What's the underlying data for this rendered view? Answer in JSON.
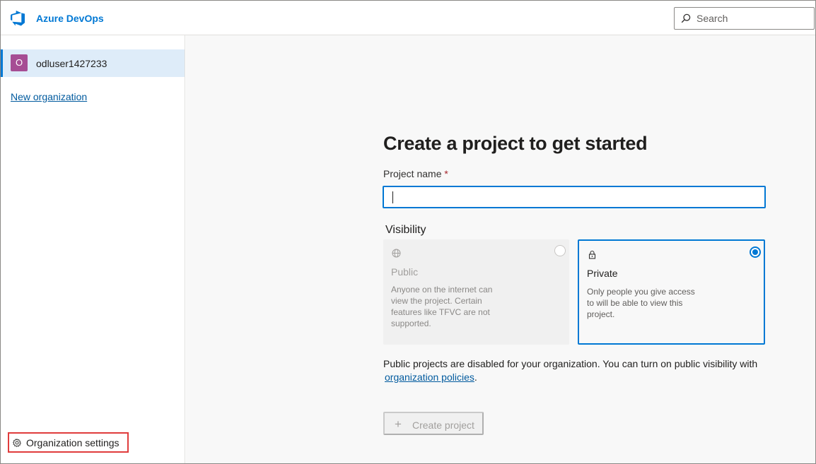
{
  "header": {
    "brand": "Azure DevOps",
    "search_placeholder": "Search",
    "icons": {
      "logo": "azure-devops-logo",
      "search": "search-icon"
    }
  },
  "sidebar": {
    "organization": {
      "avatar_initial": "O",
      "name": "odluser1427233",
      "avatar_color": "#a64d94"
    },
    "new_org_label": "New organization",
    "settings_label": "Organization settings",
    "icons": {
      "settings": "gear-icon"
    }
  },
  "main": {
    "title": "Create a project to get started",
    "project_name_label": "Project name",
    "required_marker": "*",
    "project_name_value": "",
    "visibility_label": "Visibility",
    "options": [
      {
        "title": "Public",
        "description": "Anyone on the internet can view the project. Certain features like TFVC are not supported.",
        "icon": "globe-icon",
        "selected": false,
        "disabled": true
      },
      {
        "title": "Private",
        "description": "Only people you give access to will be able to view this project.",
        "icon": "lock-icon",
        "selected": true,
        "disabled": false
      }
    ],
    "notice_text": "Public projects are disabled for your organization. You can turn on public visibility with",
    "notice_link": "organization policies",
    "notice_end": ".",
    "create_button_label": "Create project",
    "create_button_icon": "plus-icon"
  },
  "colors": {
    "accent": "#0078d4",
    "highlight_box": "#e03c3c",
    "selected_row_bg": "#deecf9",
    "main_bg": "#f8f8f8"
  }
}
